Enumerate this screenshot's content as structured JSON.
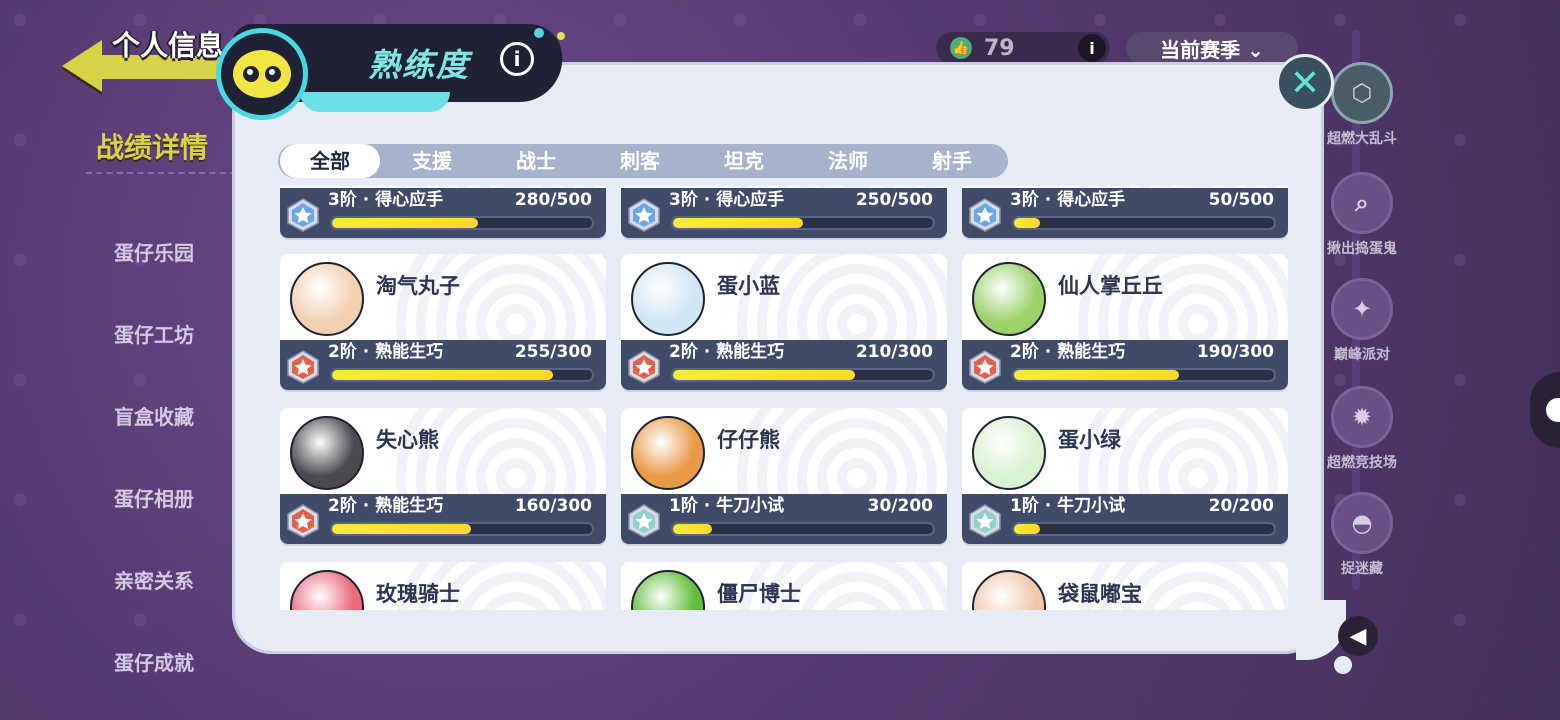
{
  "background": {
    "page_title": "个人信息",
    "section_title": "战绩详情",
    "menu": [
      "蛋仔乐园",
      "蛋仔工坊",
      "盲盒收藏",
      "蛋仔相册",
      "亲密关系",
      "蛋仔成就"
    ],
    "likes_count": "79",
    "season_selector": "当前赛季 ⌄",
    "modes": [
      {
        "label": "超燃大乱斗",
        "icon": "hexagon-icon",
        "glyph": "⬡"
      },
      {
        "label": "揪出捣蛋鬼",
        "icon": "magnifier-icon",
        "glyph": "⌕"
      },
      {
        "label": "巅峰派对",
        "icon": "rocket-icon",
        "glyph": "✦"
      },
      {
        "label": "超燃竞技场",
        "icon": "flame-icon",
        "glyph": "✹"
      },
      {
        "label": "捉迷藏",
        "icon": "car-icon",
        "glyph": "◓"
      }
    ]
  },
  "dialog": {
    "title": "熟练度",
    "info_glyph": "i",
    "close_glyph": "✕",
    "collapse_glyph": "◀",
    "tabs": [
      "全部",
      "支援",
      "战士",
      "刺客",
      "坦克",
      "法师",
      "射手"
    ],
    "active_tab": "全部"
  },
  "cards": [
    {
      "name": "",
      "rank": "3阶 · 得心应手",
      "progress": "280/500",
      "fill": 0.56,
      "tier": 3,
      "avatar_color": "#ffffff"
    },
    {
      "name": "",
      "rank": "3阶 · 得心应手",
      "progress": "250/500",
      "fill": 0.5,
      "tier": 3,
      "avatar_color": "#ffffff"
    },
    {
      "name": "",
      "rank": "3阶 · 得心应手",
      "progress": "50/500",
      "fill": 0.1,
      "tier": 3,
      "avatar_color": "#ffffff"
    },
    {
      "name": "淘气丸子",
      "rank": "2阶 · 熟能生巧",
      "progress": "255/300",
      "fill": 0.85,
      "tier": 2,
      "avatar_color": "#f4cfb0"
    },
    {
      "name": "蛋小蓝",
      "rank": "2阶 · 熟能生巧",
      "progress": "210/300",
      "fill": 0.7,
      "tier": 2,
      "avatar_color": "#cfe6f5"
    },
    {
      "name": "仙人掌丘丘",
      "rank": "2阶 · 熟能生巧",
      "progress": "190/300",
      "fill": 0.633,
      "tier": 2,
      "avatar_color": "#9bd36a"
    },
    {
      "name": "失心熊",
      "rank": "2阶 · 熟能生巧",
      "progress": "160/300",
      "fill": 0.533,
      "tier": 2,
      "avatar_color": "#4a4a4f"
    },
    {
      "name": "仔仔熊",
      "rank": "1阶 · 牛刀小试",
      "progress": "30/200",
      "fill": 0.15,
      "tier": 1,
      "avatar_color": "#e89a48"
    },
    {
      "name": "蛋小绿",
      "rank": "1阶 · 牛刀小试",
      "progress": "20/200",
      "fill": 0.1,
      "tier": 1,
      "avatar_color": "#d9f2d2"
    },
    {
      "name": "玫瑰骑士",
      "rank": "",
      "progress": "",
      "fill": 0,
      "tier": 1,
      "avatar_color": "#e86a7c"
    },
    {
      "name": "僵尸博士",
      "rank": "",
      "progress": "",
      "fill": 0,
      "tier": 1,
      "avatar_color": "#5fbf3a"
    },
    {
      "name": "袋鼠嘟宝",
      "rank": "",
      "progress": "",
      "fill": 0,
      "tier": 1,
      "avatar_color": "#f2c6a8"
    }
  ],
  "colors": {
    "accent_cyan": "#48d9e2",
    "progress_yellow": "#f7ec3a",
    "card_bar": "#404a69",
    "tier1": "#8fd0c8",
    "tier2": "#e3604a",
    "tier3": "#6aa7e8"
  }
}
